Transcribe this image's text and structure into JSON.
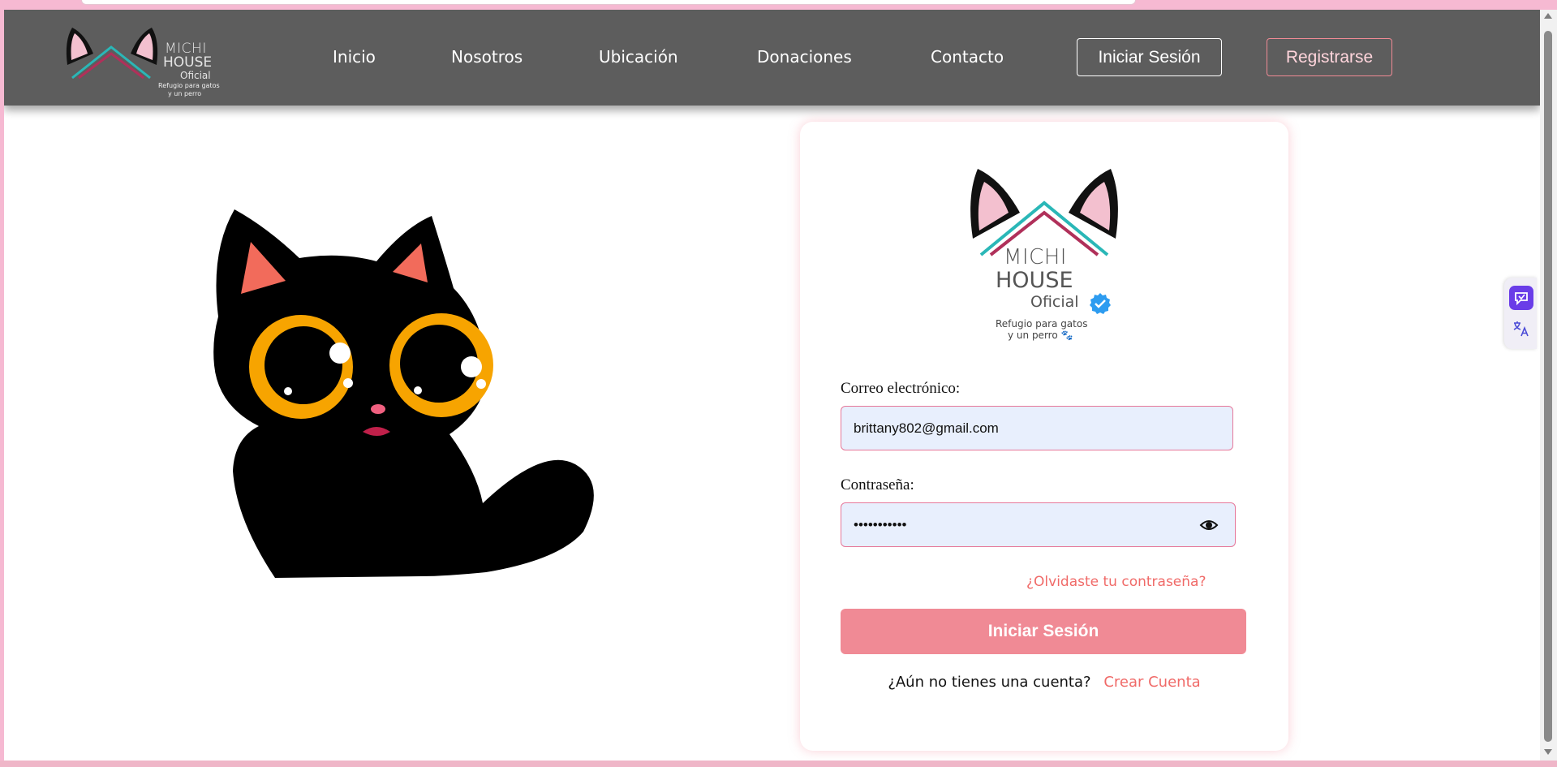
{
  "nav": {
    "logo": {
      "line1": "MICHI",
      "line2": "HOUSE",
      "line3": "Oficial",
      "line4": "Refugio para gatos",
      "line5": "y un perro"
    },
    "links": [
      "Inicio",
      "Nosotros",
      "Ubicación",
      "Donaciones",
      "Contacto"
    ],
    "login_label": "Iniciar Sesión",
    "register_label": "Registrarse"
  },
  "login_card": {
    "logo": {
      "line1": "MICHI",
      "line2": "HOUSE",
      "line3": "Oficial",
      "line4": "Refugio para gatos",
      "line5": "y un perro 🐾"
    },
    "email_label": "Correo electrónico:",
    "email_value": "brittany802@gmail.com",
    "password_label": "Contraseña:",
    "password_value": "•••••••••••",
    "forgot_label": "¿Olvidaste tu contraseña?",
    "submit_label": "Iniciar Sesión",
    "signup_question": "¿Aún no tienes una cuenta?",
    "signup_link": "Crear Cuenta"
  },
  "colors": {
    "navbar": "#5d5d5d",
    "accent_pink": "#f08a95",
    "link_coral": "#f06a68",
    "input_bg": "#e8effd",
    "page_border": "#f6b9d2"
  },
  "icons": {
    "eye": "eye-icon",
    "verified": "verified-badge-icon",
    "side_1": "chat-assistant-icon",
    "side_2": "translate-icon"
  }
}
